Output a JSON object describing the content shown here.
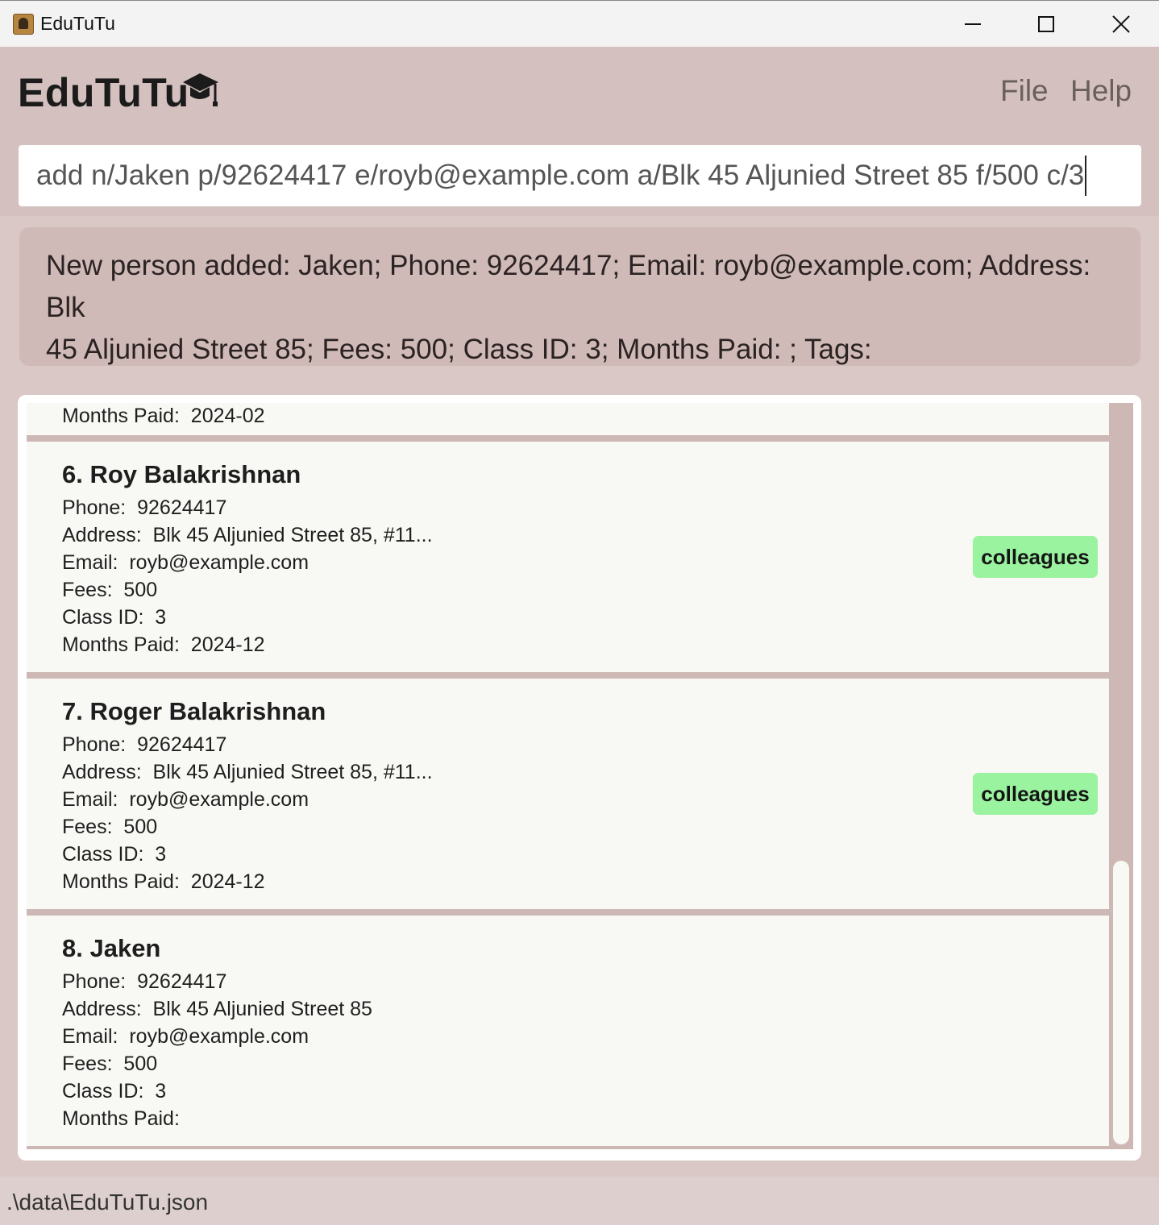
{
  "window": {
    "title": "EduTuTu",
    "controls": [
      "minimize-icon",
      "maximize-icon",
      "close-icon"
    ]
  },
  "header": {
    "brand": "EduTuTu",
    "brand_icon": "graduation-cap-icon",
    "menu": {
      "file": "File",
      "help": "Help"
    }
  },
  "command": {
    "value": "add n/Jaken p/92624417 e/royb@example.com a/Blk 45 Aljunied Street 85 f/500 c/3"
  },
  "result": {
    "line1": "New person added: Jaken; Phone: 92624417; Email: royb@example.com; Address: Blk",
    "line2": "45 Aljunied Street 85; Fees: 500; Class ID: 3; Months Paid: ; Tags:"
  },
  "persons": {
    "prev_partial": {
      "months_paid": "Months Paid:  2024-02"
    },
    "p6": {
      "name": "6. Roy Balakrishnan",
      "phone": "Phone:  92624417",
      "address": "Address:  Blk 45 Aljunied Street 85, #11...",
      "email": "Email:  royb@example.com",
      "fees": "Fees:  500",
      "class_id": "Class ID:  3",
      "months_paid": "Months Paid:  2024-12",
      "tag": "colleagues"
    },
    "p7": {
      "name": "7. Roger Balakrishnan",
      "phone": "Phone:  92624417",
      "address": "Address:  Blk 45 Aljunied Street 85, #11...",
      "email": "Email:  royb@example.com",
      "fees": "Fees:  500",
      "class_id": "Class ID:  3",
      "months_paid": "Months Paid:  2024-12",
      "tag": "colleagues"
    },
    "p8": {
      "name": "8. Jaken",
      "phone": "Phone:  92624417",
      "address": "Address:  Blk 45 Aljunied Street 85",
      "email": "Email:  royb@example.com",
      "fees": "Fees:  500",
      "class_id": "Class ID:  3",
      "months_paid": "Months Paid:"
    }
  },
  "status": {
    "path": ".\\data\\EduTuTu.json"
  },
  "colors": {
    "background": "#d4c1bf",
    "card": "#f8f8f4",
    "tag": "#99f39f"
  }
}
